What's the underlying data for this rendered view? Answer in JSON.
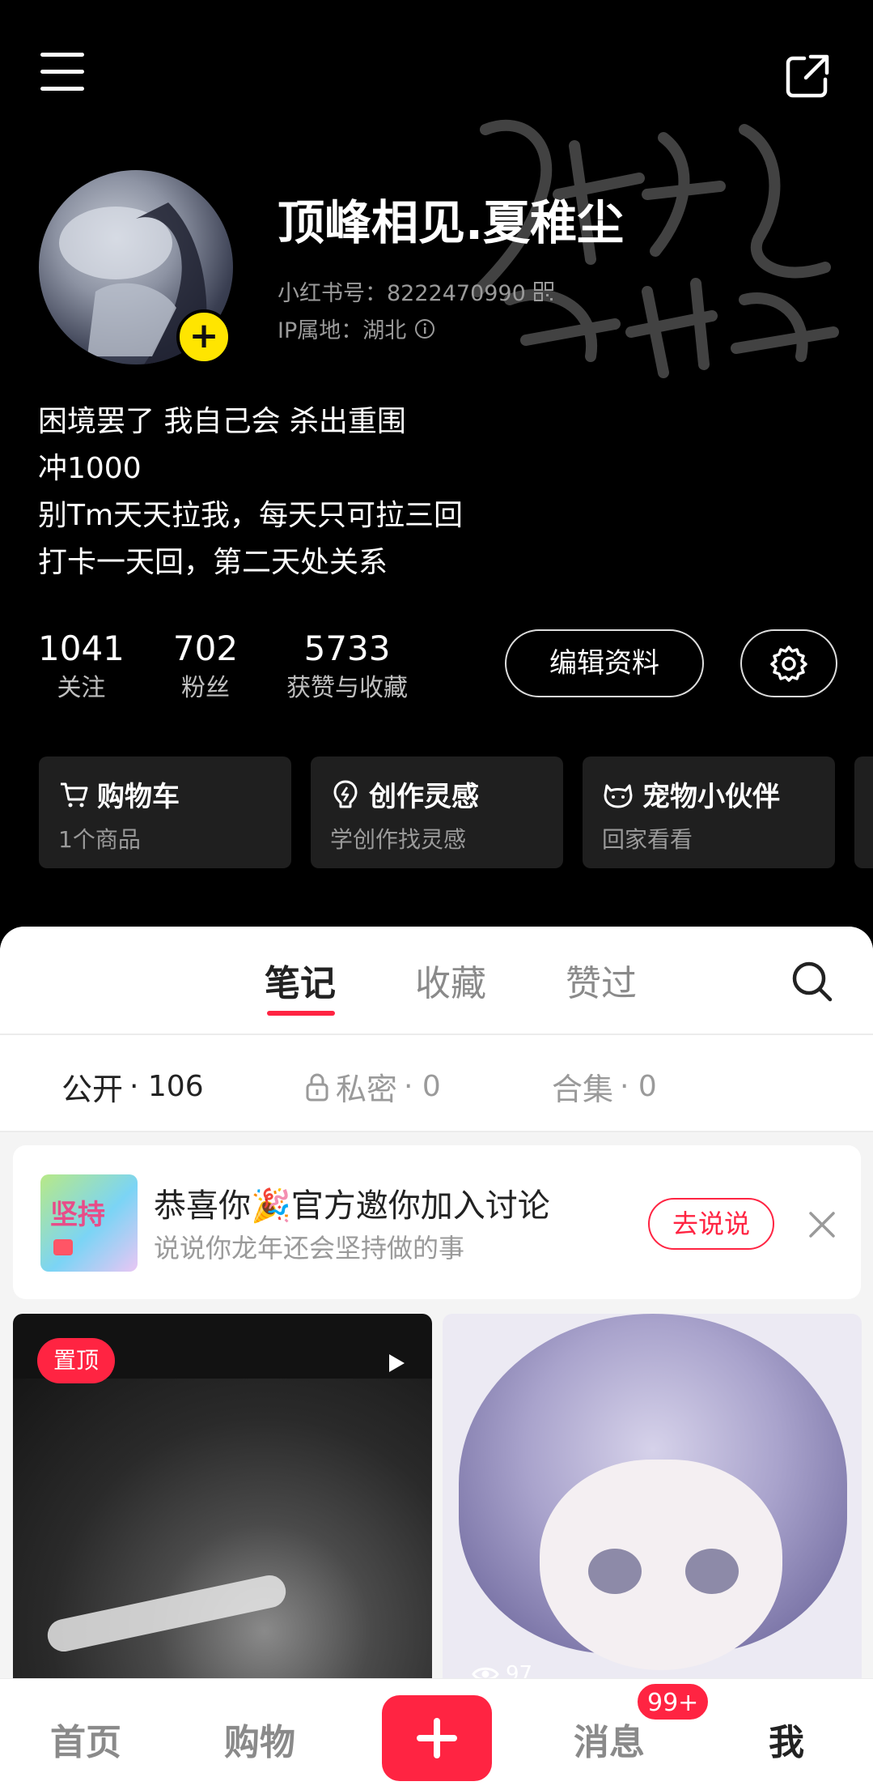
{
  "profile": {
    "name": "顶峰相见.夏稚尘",
    "id_line": "小红书号：8222470990",
    "ip_line": "IP属地：湖北",
    "bio": [
      "困境罢了 我自己会 杀出重围",
      "冲1000",
      "别Tm天天拉我，每天只可拉三回",
      "打卡一天回，第二天处关系"
    ]
  },
  "stats": [
    {
      "value": "1041",
      "label": "关注"
    },
    {
      "value": "702",
      "label": "粉丝"
    },
    {
      "value": "5733",
      "label": "获赞与收藏"
    }
  ],
  "actions": {
    "edit_label": "编辑资料"
  },
  "shortcuts": [
    {
      "title": "购物车",
      "sub": "1个商品",
      "icon": "cart-icon"
    },
    {
      "title": "创作灵感",
      "sub": "学创作找灵感",
      "icon": "bulb-icon"
    },
    {
      "title": "宠物小伙伴",
      "sub": "回家看看",
      "icon": "pet-icon"
    }
  ],
  "tabs": [
    {
      "label": "笔记",
      "active": true
    },
    {
      "label": "收藏",
      "active": false
    },
    {
      "label": "赞过",
      "active": false
    }
  ],
  "filters": [
    {
      "label": "公开",
      "count": "· 106",
      "active": true
    },
    {
      "label": "私密",
      "count": "· 0",
      "active": false,
      "icon": "lock-icon"
    },
    {
      "label": "合集",
      "count": "· 0",
      "active": false
    }
  ],
  "banner": {
    "title": "恭喜你🎉官方邀你加入讨论",
    "subtitle": "说说你龙年还会坚持做的事",
    "button": "去说说",
    "thumb_text": "坚持"
  },
  "notes": [
    {
      "badge": "置顶",
      "type": "video"
    },
    {
      "views": "97",
      "type": "image"
    }
  ],
  "bottom_nav": {
    "home": "首页",
    "shop": "购物",
    "messages": "消息",
    "messages_badge": "99+",
    "me": "我"
  },
  "colors": {
    "accent": "#ff2442",
    "avatar_add": "#ffe500"
  }
}
